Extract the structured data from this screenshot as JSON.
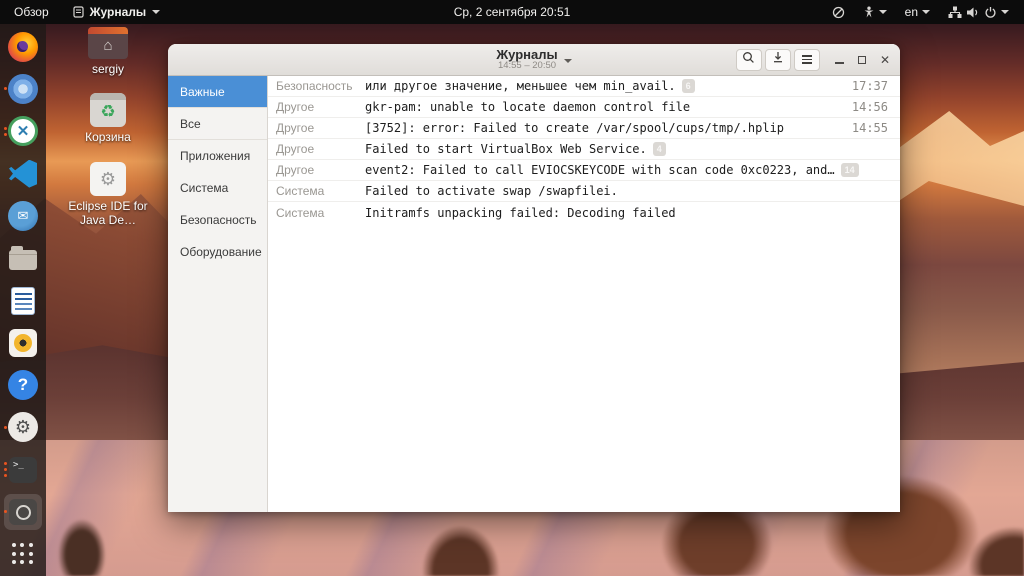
{
  "topbar": {
    "activities_label": "Обзор",
    "app_menu_label": "Журналы",
    "clock": "Ср, 2 сентября  20:51",
    "keyboard_layout": "en"
  },
  "desktop": {
    "icons": [
      {
        "name": "home-folder",
        "label": "sergiy"
      },
      {
        "name": "trash",
        "label": "Корзина"
      },
      {
        "name": "eclipse-installer",
        "label": "Eclipse IDE for Java De…"
      }
    ]
  },
  "dock": {
    "items": [
      {
        "icon": "firefox-icon"
      },
      {
        "icon": "chromium-icon"
      },
      {
        "icon": "x-app-icon"
      },
      {
        "icon": "vscode-icon"
      },
      {
        "icon": "thunderbird-icon"
      },
      {
        "icon": "files-icon"
      },
      {
        "icon": "libreoffice-writer-icon"
      },
      {
        "icon": "rhythmbox-icon"
      },
      {
        "icon": "help-icon"
      },
      {
        "icon": "settings-icon"
      },
      {
        "icon": "terminal-icon"
      },
      {
        "icon": "logs-app-icon"
      },
      {
        "icon": "app-grid-icon"
      }
    ]
  },
  "window": {
    "title": "Журналы",
    "subtitle": "14:55 – 20:50",
    "accent_color": "#4a8fd6",
    "sidebar": {
      "items": [
        {
          "label": "Важные",
          "selected": true
        },
        {
          "label": "Все",
          "selected": false
        },
        {
          "label": "Приложения",
          "selected": false
        },
        {
          "label": "Система",
          "selected": false
        },
        {
          "label": "Безопасность",
          "selected": false
        },
        {
          "label": "Оборудование",
          "selected": false
        }
      ]
    },
    "log_rows": [
      {
        "category": "Безопасность",
        "message": "или другое значение, меньшее чем min_avail.",
        "badge": "6",
        "time": "17:37"
      },
      {
        "category": "Другое",
        "message": "gkr-pam: unable to locate daemon control file",
        "time": "14:56"
      },
      {
        "category": "Другое",
        "message": "[3752]: error: Failed to create /var/spool/cups/tmp/.hplip",
        "time": "14:55"
      },
      {
        "category": "Другое",
        "message": "Failed to start VirtualBox Web Service.",
        "badge": "4"
      },
      {
        "category": "Другое",
        "message": "event2: Failed to call EVIOCSKEYCODE with scan code 0xc0223, and…",
        "badge": "14"
      },
      {
        "category": "Система",
        "message": "Failed to activate swap /swapfilei."
      },
      {
        "category": "Система",
        "message": "Initramfs unpacking failed: Decoding failed"
      }
    ]
  }
}
